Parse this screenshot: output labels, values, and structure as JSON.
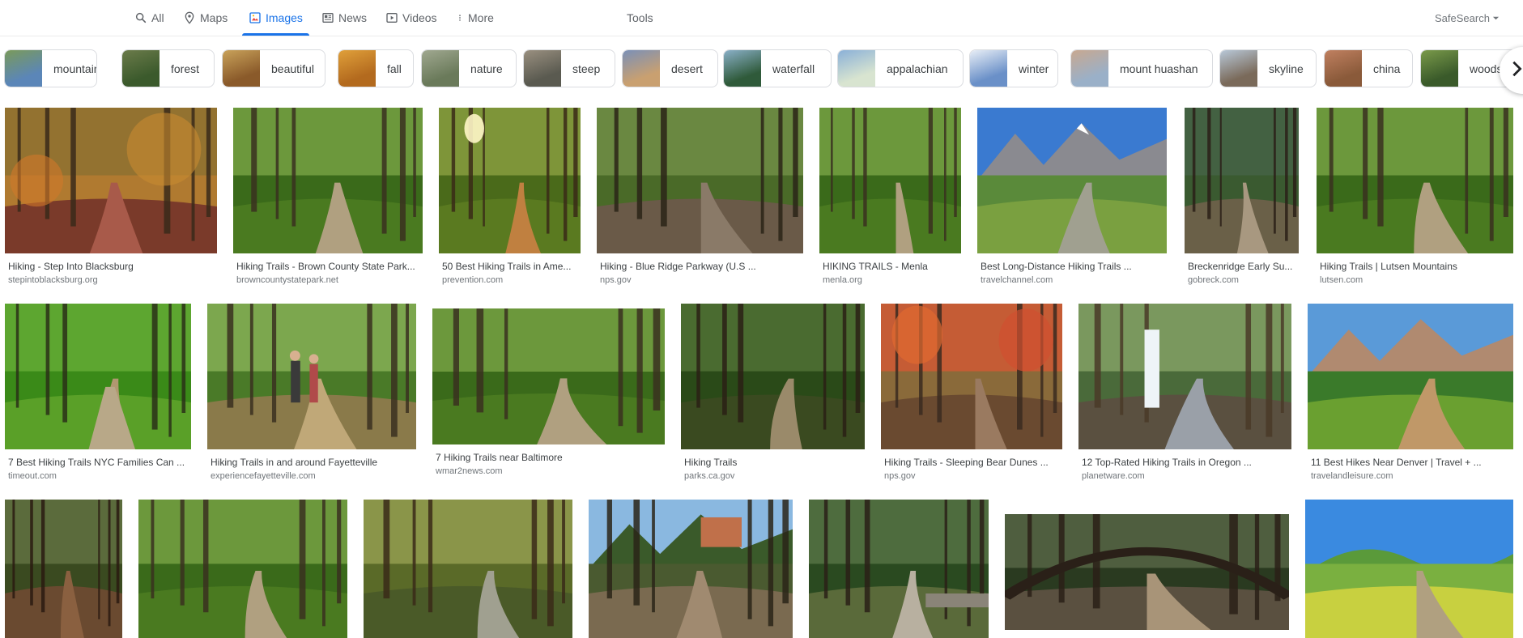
{
  "nav": {
    "tabs": [
      {
        "label": "All",
        "icon": "search-icon"
      },
      {
        "label": "Maps",
        "icon": "map-pin-icon"
      },
      {
        "label": "Images",
        "icon": "image-icon"
      },
      {
        "label": "News",
        "icon": "newspaper-icon"
      },
      {
        "label": "Videos",
        "icon": "play-icon"
      },
      {
        "label": "More",
        "icon": "more-vert-icon"
      }
    ],
    "active_tab": "Images",
    "tools_label": "Tools",
    "safesearch_label": "SafeSearch"
  },
  "chips": [
    {
      "label": "mountain"
    },
    {
      "label": "forest"
    },
    {
      "label": "beautiful"
    },
    {
      "label": "fall"
    },
    {
      "label": "nature"
    },
    {
      "label": "steep"
    },
    {
      "label": "desert"
    },
    {
      "label": "waterfall"
    },
    {
      "label": "appalachian"
    },
    {
      "label": "winter"
    },
    {
      "label": "mount huashan"
    },
    {
      "label": "skyline"
    },
    {
      "label": "china"
    },
    {
      "label": "woods"
    }
  ],
  "results": [
    {
      "title": "Hiking - Step Into Blacksburg",
      "source": "stepintoblacksburg.org",
      "scene": "autumn"
    },
    {
      "title": "Hiking Trails - Brown County State Park...",
      "source": "browncountystatepark.net",
      "scene": "forest"
    },
    {
      "title": "50 Best Hiking Trails in Ame...",
      "source": "prevention.com",
      "scene": "sunforest"
    },
    {
      "title": "Hiking - Blue Ridge Parkway (U.S ...",
      "source": "nps.gov",
      "scene": "rocky"
    },
    {
      "title": "HIKING TRAILS - Menla",
      "source": "menla.org",
      "scene": "forest"
    },
    {
      "title": "Best Long-Distance Hiking Trails ...",
      "source": "travelchannel.com",
      "scene": "mountain"
    },
    {
      "title": "Breckenridge Early Su...",
      "source": "gobreck.com",
      "scene": "pine"
    },
    {
      "title": "Hiking Trails | Lutsen Mountains",
      "source": "lutsen.com",
      "scene": "forest"
    },
    {
      "title": "7 Best Hiking Trails NYC Families Can ...",
      "source": "timeout.com",
      "scene": "boardwalk"
    },
    {
      "title": "Hiking Trails in and around Fayetteville",
      "source": "experiencefayetteville.com",
      "scene": "hikers"
    },
    {
      "title": "7 Hiking Trails near Baltimore",
      "source": "wmar2news.com",
      "scene": "forest"
    },
    {
      "title": "Hiking Trails",
      "source": "parks.ca.gov",
      "scene": "darkforest"
    },
    {
      "title": "Hiking Trails - Sleeping Bear Dunes ...",
      "source": "nps.gov",
      "scene": "fallred"
    },
    {
      "title": "12 Top-Rated Hiking Trails in Oregon ...",
      "source": "planetware.com",
      "scene": "waterfall"
    },
    {
      "title": "11 Best Hikes Near Denver | Travel + ...",
      "source": "travelandleisure.com",
      "scene": "meadow"
    },
    {
      "title": "",
      "source": "",
      "scene": "roots"
    },
    {
      "title": "",
      "source": "",
      "scene": "forest"
    },
    {
      "title": "",
      "source": "",
      "scene": "stones"
    },
    {
      "title": "",
      "source": "",
      "scene": "desert"
    },
    {
      "title": "",
      "source": "",
      "scene": "stonewall"
    },
    {
      "title": "",
      "source": "",
      "scene": "arch"
    },
    {
      "title": "",
      "source": "",
      "scene": "hills"
    }
  ],
  "colors": {
    "accent": "#1a73e8",
    "text_muted": "#5f6368",
    "chip_border": "#dadce0"
  }
}
